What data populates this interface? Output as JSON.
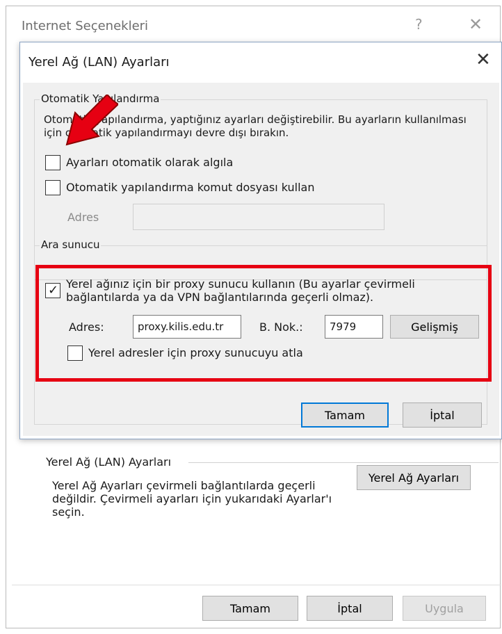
{
  "outer": {
    "title": "Internet Seçenekleri",
    "help_glyph": "?",
    "close_glyph": "✕",
    "lan_section": {
      "legend": "Yerel Ağ (LAN) Ayarları",
      "description": "Yerel Ağ Ayarları çevirmeli bağlantılarda geçerli değildir. Çevirmeli ayarları için yukarıdaki Ayarlar'ı seçin.",
      "button": "Yerel Ağ Ayarları"
    },
    "buttons": {
      "ok": "Tamam",
      "cancel": "İptal",
      "apply": "Uygula"
    }
  },
  "dialog": {
    "title": "Yerel Ağ (LAN) Ayarları",
    "close_glyph": "✕",
    "auto_config": {
      "legend": "Otomatik Yapılandırma",
      "description": "Otomatik yapılandırma, yaptığınız ayarları değiştirebilir. Bu ayarların kullanılması için otomatik yapılandırmayı devre dışı bırakın.",
      "detect_label": "Ayarları otomatik olarak algıla",
      "detect_checked": false,
      "script_label": "Otomatik yapılandırma komut dosyası kullan",
      "script_checked": false,
      "address_label": "Adres",
      "address_value": ""
    },
    "proxy": {
      "legend": "Ara sunucu",
      "use_proxy_label": "Yerel ağınız için bir proxy sunucu kullanın (Bu ayarlar çevirmeli bağlantılarda ya da VPN bağlantılarında geçerli olmaz).",
      "use_proxy_checked": true,
      "checkmark": "✓",
      "address_label": "Adres:",
      "address_value": "proxy.kilis.edu.tr",
      "port_label": "B. Nok.:",
      "port_value": "7979",
      "advanced_button": "Gelişmiş",
      "bypass_label": "Yerel adresler için proxy sunucuyu atla",
      "bypass_checked": false
    },
    "buttons": {
      "ok": "Tamam",
      "cancel": "İptal"
    }
  },
  "annotation": {
    "frame_color": "#e60012",
    "arrow_color": "#e60012"
  }
}
